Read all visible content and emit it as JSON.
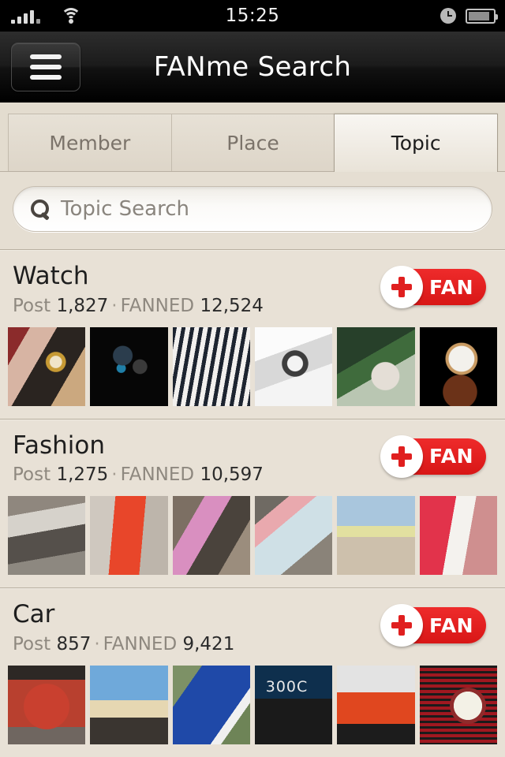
{
  "statusbar": {
    "time": "15:25",
    "signal_icon": "signal-bars-icon",
    "wifi_icon": "wifi-icon",
    "alarm_icon": "alarm-clock-icon",
    "battery_icon": "battery-icon"
  },
  "navbar": {
    "title": "FANme Search",
    "menu_icon": "hamburger-menu-icon"
  },
  "tabs": [
    {
      "label": "Member",
      "active": false
    },
    {
      "label": "Place",
      "active": false
    },
    {
      "label": "Topic",
      "active": true
    }
  ],
  "search": {
    "placeholder": "Topic Search",
    "value": "",
    "icon": "search-icon"
  },
  "labels": {
    "post": "Post",
    "fanned": "FANNED",
    "separator": "·",
    "fan_button": "FAN",
    "fan_plus_icon": "plus-icon"
  },
  "colors": {
    "accent_red": "#e01f1f",
    "background": "#e8e0d5",
    "navbar": "#000000",
    "tab_active_text": "#1c1c1c",
    "tab_inactive_text": "#7b736a"
  },
  "topics": [
    {
      "name": "Watch",
      "post_count": "1,827",
      "fanned_count": "12,524",
      "thumbs": [
        {
          "name": "thumb-gold-watch-wrist",
          "cls": "t-w1"
        },
        {
          "name": "thumb-black-luxury-watch",
          "cls": "t-w2"
        },
        {
          "name": "thumb-striped-shirt-watch",
          "cls": "t-w3"
        },
        {
          "name": "thumb-chronograph-watch",
          "cls": "t-w4"
        },
        {
          "name": "thumb-outdoor-wrist-watch",
          "cls": "t-w5"
        },
        {
          "name": "thumb-rose-gold-watch",
          "cls": "t-w6"
        }
      ]
    },
    {
      "name": "Fashion",
      "post_count": "1,275",
      "fanned_count": "10,597",
      "thumbs": [
        {
          "name": "thumb-street-style-white-tee",
          "cls": "t-f1"
        },
        {
          "name": "thumb-orange-coat",
          "cls": "t-f2"
        },
        {
          "name": "thumb-pink-dress-street",
          "cls": "t-f3"
        },
        {
          "name": "thumb-floral-dress-pink-fur",
          "cls": "t-f4"
        },
        {
          "name": "thumb-beach-yellow-top",
          "cls": "t-f5"
        },
        {
          "name": "thumb-white-dress-red-door",
          "cls": "t-f6"
        }
      ]
    },
    {
      "name": "Car",
      "post_count": "857",
      "fanned_count": "9,421",
      "thumbs": [
        {
          "name": "thumb-red-classic-car-rear",
          "cls": "t-c1"
        },
        {
          "name": "thumb-man-open-hood-car",
          "cls": "t-c2"
        },
        {
          "name": "thumb-blue-cobra-roadster",
          "cls": "t-c3",
          "caption": ""
        },
        {
          "name": "thumb-chrysler-300c-show",
          "cls": "t-c4",
          "caption": "300C"
        },
        {
          "name": "thumb-orange-mustang",
          "cls": "t-c5"
        },
        {
          "name": "thumb-red-grille-headlight",
          "cls": "t-c6"
        }
      ]
    }
  ]
}
